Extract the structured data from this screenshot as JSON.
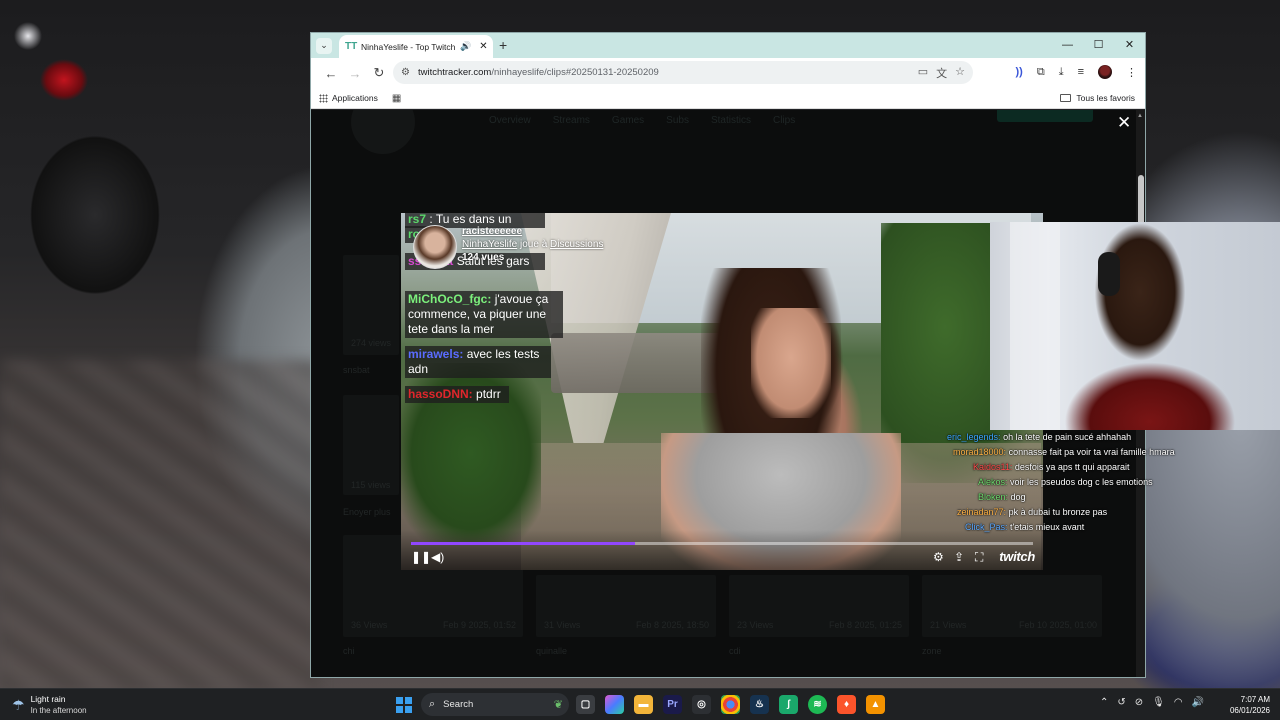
{
  "browser": {
    "tab": {
      "title": "NinhaYeslife - Top Twitch C"
    },
    "url_host": "twitchtracker.com",
    "url_path": "/ninhayeslife/clips#20250131-20250209",
    "bookmarks": {
      "apps_label": "Applications",
      "all_favorites": "Tous les favoris"
    }
  },
  "page": {
    "nav": [
      "Overview",
      "Streams",
      "Games",
      "Subs",
      "Statistics",
      "Clips"
    ],
    "close_glyph": "✕",
    "dimmed_text": {
      "v1": "274 views",
      "t1": "snsbat",
      "v2": "115 views",
      "t2": "Enoyer plus",
      "c1": "36 Views",
      "d1": "Feb 9 2025, 01:52",
      "c2": "31 Views",
      "d2": "Feb 8 2025, 18:50",
      "c3": "23 Views",
      "d3": "Feb 8 2025, 01:25",
      "c4": "21 Views",
      "d4": "Feb 10 2025, 01:00",
      "f1": "chi",
      "f2": "quinalle",
      "f3": "cdi",
      "f4": "zone"
    }
  },
  "clip": {
    "title": "racisteeeeee",
    "channel": "NinhaYeslife",
    "plays_text": "joue à",
    "game": "Discussions",
    "views": "124 vues",
    "progress_fraction": 0.36,
    "brand": "twitch",
    "chat": [
      {
        "user": "rs7",
        "user_color": "#5bd96b",
        "text": ": Tu es dans un"
      },
      {
        "user": "ro",
        "user_color": "#5bd96b",
        "text": ""
      },
      {
        "user": "ssnsbat",
        "user_color": "#d64ad0",
        "text": "Salut les gars"
      },
      {
        "user": "MiChOcO_fgc:",
        "user_color": "#7cf07c",
        "text": "j'avoue ça commence, va piquer une tete dans la mer"
      },
      {
        "user": "mirawels:",
        "user_color": "#5a6cff",
        "text": "avec les tests adn"
      },
      {
        "user": "hassoDNN:",
        "user_color": "#e0262c",
        "text": "ptdrr"
      }
    ]
  },
  "overlay_chat": [
    {
      "user": "eric_legends:",
      "color": "#3da8ff",
      "text": "oh la tete de pain sucé ahhahah"
    },
    {
      "user": "morad18000:",
      "color": "#ffb347",
      "text": "connasse fait pa voir ta vrai famille hmara"
    },
    {
      "user": "Kaidos11:",
      "color": "#ff4d4d",
      "text": "desfois ya aps tt qui apparait"
    },
    {
      "user": "Alekos:",
      "color": "#6fdc6f",
      "text": "voir les pseudos dog c les emotions"
    },
    {
      "user": "Bloken:",
      "color": "#6fdc6f",
      "text": "dog"
    },
    {
      "user": "zeinadan77:",
      "color": "#ffb347",
      "text": "pk à dubai tu bronze pas"
    },
    {
      "user": "Click_Pas:",
      "color": "#5da9ff",
      "text": "t'etais mieux avant"
    }
  ],
  "taskbar": {
    "weather_line1": "Light rain",
    "weather_line2": "In the afternoon",
    "search_label": "Search",
    "time": "7:07 AM",
    "date": "06/01/2026"
  },
  "colors": {
    "tabbar": "#c9e6e3",
    "progress": "#9147ff",
    "twitch_tracker": "#3ea58f"
  },
  "icons": [
    "tab-list-icon",
    "twitchtracker-favicon",
    "audio-icon",
    "tab-close-icon",
    "new-tab-icon",
    "minimize-icon",
    "maximize-icon",
    "window-close-icon",
    "back-icon",
    "forward-icon",
    "reload-icon",
    "site-info-icon",
    "install-icon",
    "translate-icon",
    "star-icon",
    "extension-icon",
    "puzzle-icon",
    "download-icon",
    "media-icon",
    "profile-avatar",
    "menu-icon",
    "apps-grid-icon",
    "folder-icon",
    "pause-icon",
    "volume-icon",
    "settings-icon",
    "share-icon",
    "fullscreen-icon",
    "weather-icon",
    "start-icon",
    "search-icon"
  ]
}
